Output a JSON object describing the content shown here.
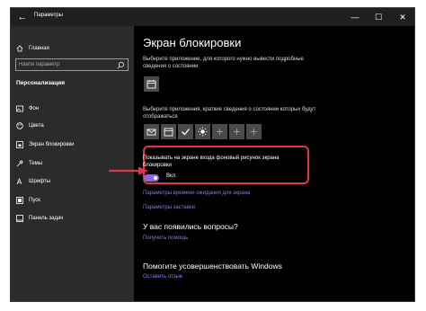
{
  "window": {
    "title": "Параметры"
  },
  "controls": {
    "back": "←",
    "minimize": "—",
    "maximize": "☐",
    "close": "✕"
  },
  "sidebar": {
    "home": "Главная",
    "search_placeholder": "Найти параметр",
    "section_heading": "Персонализация",
    "items": [
      {
        "label": "Фон",
        "icon": "image-icon"
      },
      {
        "label": "Цвета",
        "icon": "palette-icon"
      },
      {
        "label": "Экран блокировки",
        "icon": "lock-screen-icon"
      },
      {
        "label": "Темы",
        "icon": "brush-icon"
      },
      {
        "label": "Шрифты",
        "icon": "font-icon"
      },
      {
        "label": "Пуск",
        "icon": "start-icon"
      },
      {
        "label": "Панель задач",
        "icon": "taskbar-icon"
      }
    ]
  },
  "main": {
    "title": "Экран блокировки",
    "detail_desc": "Выберите приложение, для которого нужно вывести подробные сведения о состоянии",
    "quick_desc": "Выберите приложения, краткие сведения о состоянии которых будут отображаться",
    "quick_tiles": [
      "mail-icon",
      "calendar-icon",
      "check-icon",
      "weather-icon",
      "plus-icon",
      "plus-icon",
      "plus-icon"
    ],
    "toggle_label": "Показывать на экране входа фоновый рисунок экрана блокировки",
    "toggle_state": "Вкл.",
    "toggle_on": true,
    "link_timeout": "Параметры времени ожидания для экрана",
    "link_screensaver": "Параметры заставки",
    "questions_heading": "У вас появились вопросы?",
    "help_link": "Получить помощь",
    "improve_heading": "Помогите усовершенствовать Windows",
    "feedback_link": "Оставить отзыв"
  },
  "colors": {
    "accent": "#8a6bd6",
    "highlight": "#e0354a",
    "sidebar": "#2b2b2b",
    "main": "#000000"
  }
}
